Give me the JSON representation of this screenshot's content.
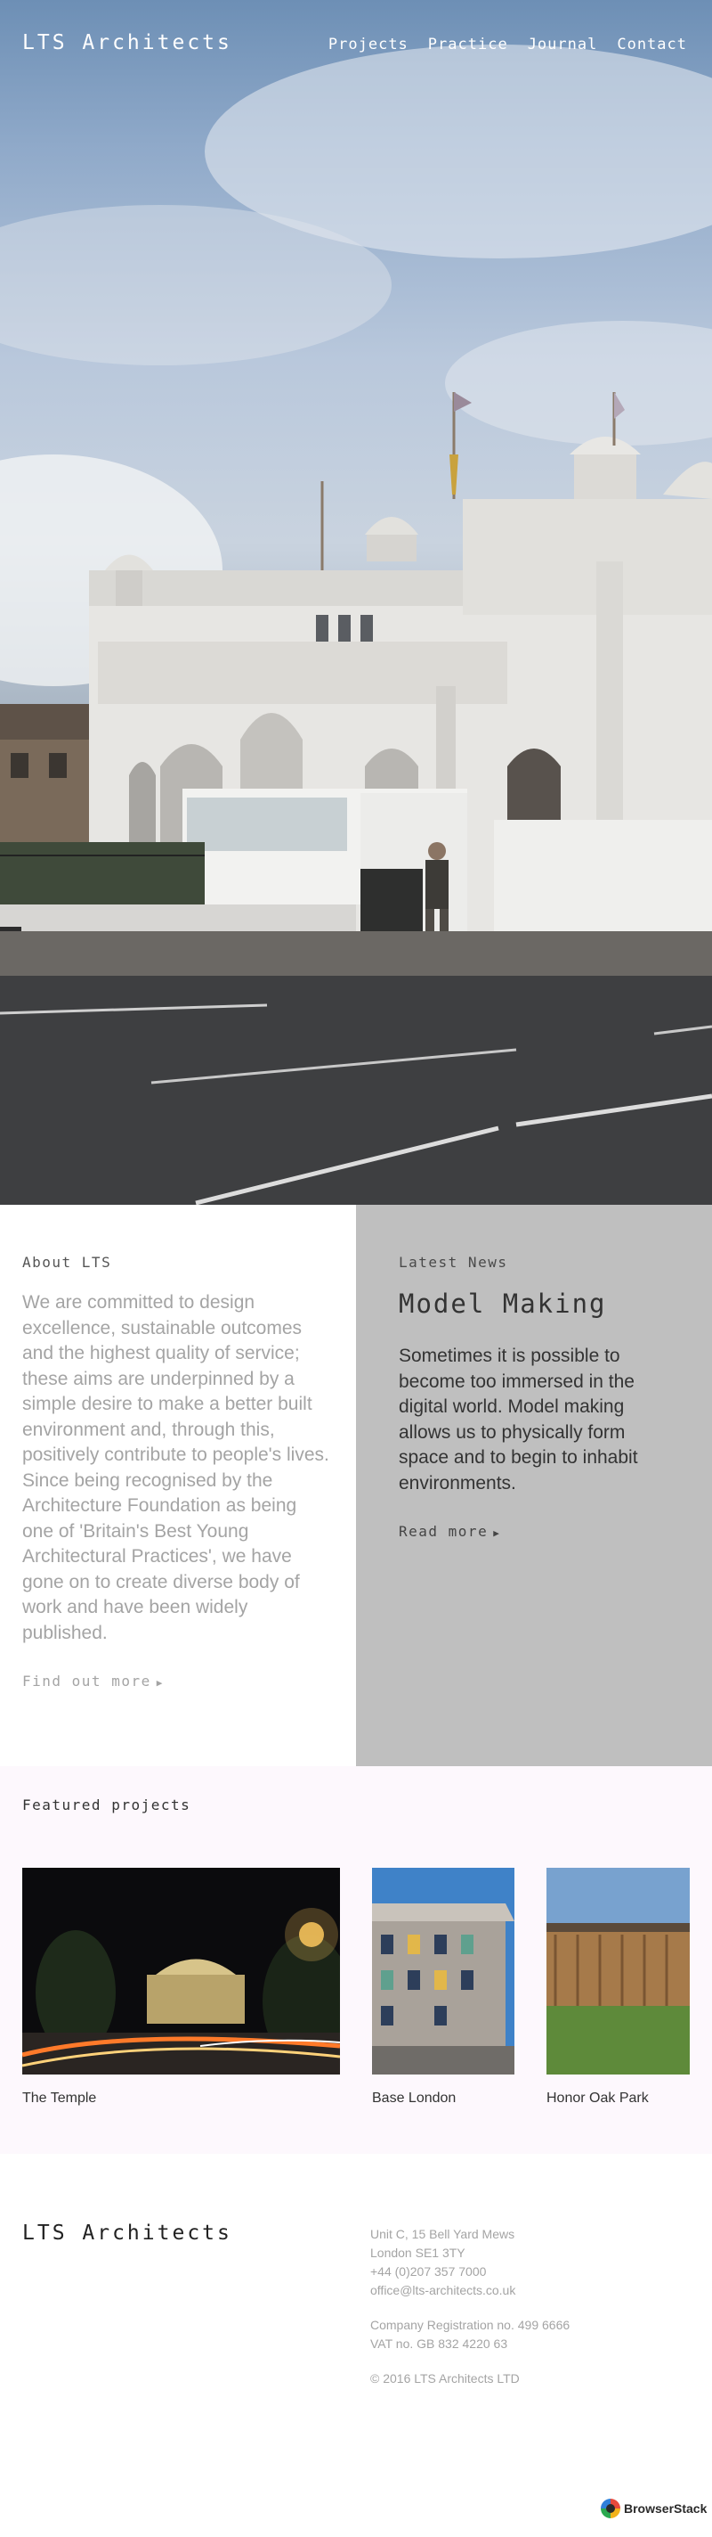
{
  "header": {
    "logo": "LTS Architects",
    "nav": [
      "Projects",
      "Practice",
      "Journal",
      "Contact"
    ]
  },
  "about": {
    "heading": "About LTS",
    "text": "We are committed to design excellence, sustainable outcomes and the highest quality of service; these aims are underpinned by a simple desire to make a better built environment and, through this, positively contribute to people's lives. Since being recognised by the Architecture Foundation as being one of 'Britain's Best Young Architectural Practices', we have gone on to create diverse body of work and have been widely published.",
    "link": "Find out more"
  },
  "news": {
    "heading": "Latest News",
    "title": "Model Making",
    "text": "Sometimes it is possible to become too immersed in the digital world. Model making allows us to physically form space and to begin to inhabit environments.",
    "link": "Read more"
  },
  "featured": {
    "heading": "Featured projects",
    "projects": [
      {
        "name": "The Temple"
      },
      {
        "name": "Base London"
      },
      {
        "name": "Honor Oak Park"
      }
    ]
  },
  "footer": {
    "logo": "LTS Architects",
    "address_lines": [
      "Unit C, 15 Bell Yard Mews",
      "London SE1 3TY",
      "+44 (0)207 357 7000",
      "office@lts-architects.co.uk"
    ],
    "company_lines": [
      "Company Registration no. 499 6666",
      "VAT no. GB 832 4220 63"
    ],
    "copyright": "© 2016 LTS Architects LTD"
  },
  "badge": {
    "label": "BrowserStack"
  },
  "colors": {
    "news_bg": "#bfbfbf",
    "featured_bg": "#fdf8fd",
    "muted_text": "#a4a4a4"
  }
}
